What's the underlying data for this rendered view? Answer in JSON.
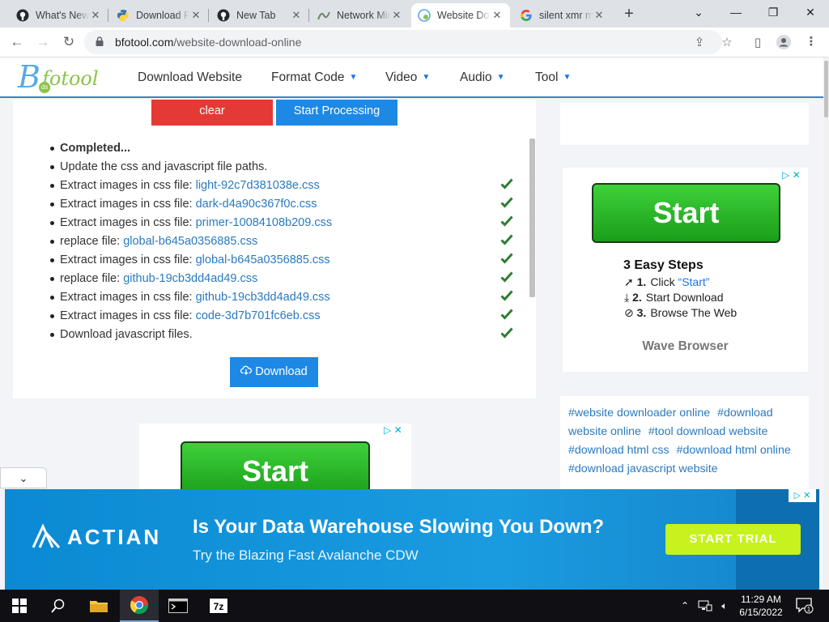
{
  "browser": {
    "tabs": [
      {
        "title": "What's New",
        "icon": "github-icon",
        "active": false
      },
      {
        "title": "Download Python",
        "icon": "python-icon",
        "active": false
      },
      {
        "title": "New Tab",
        "icon": "github-icon",
        "active": false
      },
      {
        "title": "Network Miner",
        "icon": "network-icon",
        "active": false
      },
      {
        "title": "Website Download",
        "icon": "bfotool-icon",
        "active": true
      },
      {
        "title": "silent xmr miner",
        "icon": "google-icon",
        "active": false
      }
    ],
    "url_host": "bfotool.com",
    "url_path": "/website-download-online"
  },
  "site": {
    "logo_text": "fotool",
    "logo_letter": "B",
    "logo_badge": "ds",
    "menu": [
      "Download Website",
      "Format Code",
      "Video",
      "Audio",
      "Tool"
    ],
    "menu_has_caret": [
      false,
      true,
      true,
      true,
      true
    ]
  },
  "tool": {
    "clear_label": "clear",
    "start_label": "Start Processing",
    "download_label": "Download",
    "log": [
      {
        "text": "Completed...",
        "link": "",
        "bold": true,
        "check": false
      },
      {
        "text": "Update the css and javascript file paths.",
        "link": "",
        "bold": false,
        "check": false
      },
      {
        "text": "Extract images in css file: ",
        "link": "light-92c7d381038e.css",
        "bold": false,
        "check": true
      },
      {
        "text": "Extract images in css file: ",
        "link": "dark-d4a90c367f0c.css",
        "bold": false,
        "check": true
      },
      {
        "text": "Extract images in css file: ",
        "link": "primer-10084108b209.css",
        "bold": false,
        "check": true
      },
      {
        "text": "replace file: ",
        "link": "global-b645a0356885.css",
        "bold": false,
        "check": true
      },
      {
        "text": "Extract images in css file: ",
        "link": "global-b645a0356885.css",
        "bold": false,
        "check": true
      },
      {
        "text": "replace file: ",
        "link": "github-19cb3dd4ad49.css",
        "bold": false,
        "check": true
      },
      {
        "text": "Extract images in css file: ",
        "link": "github-19cb3dd4ad49.css",
        "bold": false,
        "check": true
      },
      {
        "text": "Extract images in css file: ",
        "link": "code-3d7b701fc6eb.css",
        "bold": false,
        "check": true
      },
      {
        "text": "Download javascript files.",
        "link": "",
        "bold": false,
        "check": true
      }
    ]
  },
  "ads": {
    "start_label": "Start",
    "steps_title": "3 Easy Steps",
    "steps": [
      {
        "num": "1.",
        "text": "Click ",
        "quoted": "“Start”",
        "icon": "cursor-icon"
      },
      {
        "num": "2.",
        "text": "Start Download",
        "quoted": "",
        "icon": "download-icon"
      },
      {
        "num": "3.",
        "text": "Browse The Web",
        "quoted": "",
        "icon": "check-circle-icon"
      }
    ],
    "brand": "Wave Browser"
  },
  "tags": [
    "#website downloader online",
    "#download website online",
    "#tool download website",
    "#download html css",
    "#download html online",
    "#download javascript website"
  ],
  "banner": {
    "brand": "ACTIAN",
    "headline": "Is Your Data Warehouse Slowing You Down?",
    "sub": "Try the Blazing Fast Avalanche CDW",
    "cta": "START TRIAL"
  },
  "taskbar": {
    "time": "11:29 AM",
    "date": "6/15/2022",
    "notification_count": "1"
  },
  "colors": {
    "accent": "#1e88e5",
    "clear_button": "#e53935",
    "check": "#2e7d32",
    "link": "#2a7ac0"
  }
}
